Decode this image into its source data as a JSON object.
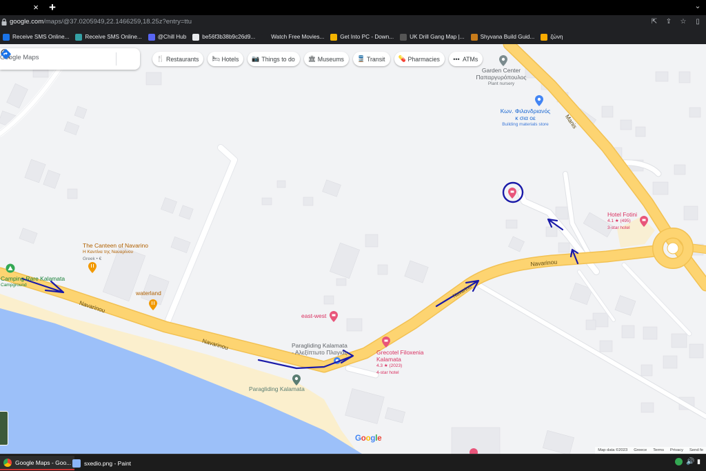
{
  "browser": {
    "tab_close_label": "×",
    "new_tab_label": "+",
    "url_host": "google.com",
    "url_path": "/maps/@37.0205949,22.1466259,18.25z?entry=ttu"
  },
  "bookmarks": [
    {
      "label": "Receive SMS Online...",
      "color": "#1a73e8"
    },
    {
      "label": "Receive SMS Online...",
      "color": "#34a0a4"
    },
    {
      "label": "@Chill Hub",
      "color": "#5865f2"
    },
    {
      "label": "be56f3b38b9c26d9...",
      "color": "#e8eaed"
    },
    {
      "label": "Watch Free Movies...",
      "color": "#202124"
    },
    {
      "label": "Get Into PC - Down...",
      "color": "#f4b400"
    },
    {
      "label": "UK Drill Gang Map |...",
      "color": "#555"
    },
    {
      "label": "Shyvana Build Guid...",
      "color": "#c77b1a"
    },
    {
      "label": "ζώνη",
      "color": "#f9ab00"
    }
  ],
  "search": {
    "placeholder": "Google Maps"
  },
  "chips": [
    {
      "label": "Restaurants",
      "icon": "🍴"
    },
    {
      "label": "Hotels",
      "icon": "🛏"
    },
    {
      "label": "Things to do",
      "icon": "📷"
    },
    {
      "label": "Museums",
      "icon": "🏛"
    },
    {
      "label": "Transit",
      "icon": "🚆"
    },
    {
      "label": "Pharmacies",
      "icon": "💊"
    },
    {
      "label": "ATMs",
      "icon": "•••"
    }
  ],
  "places": {
    "garden_center": {
      "title": "Garden Center",
      "title2": "Παπαργυρόπουλος",
      "sub": "Plant nursery"
    },
    "kon": {
      "title": "Κων. Φιλανδριανός",
      "title2": "κ σια οε",
      "sub": "Building materials store"
    },
    "hotel_fotini": {
      "title": "Hotel Fotini",
      "rating": "4.1 ★ (495)",
      "sub": "3-star hotel"
    },
    "canteen": {
      "title": "The Canteen of Navarino",
      "title2": "Η Καντίνα της Ναυαρίνου",
      "sub": "Greek • €"
    },
    "camping": {
      "title": "Camping Rare Kalamata",
      "sub": "Campground"
    },
    "waterland": {
      "title": "waterland"
    },
    "east_west": {
      "title": "east-west"
    },
    "paragliding_kal": {
      "title": "Paragliding Kalamata",
      "title2": "- Αλεξίπτωτο Πλαγιάς"
    },
    "grecotel": {
      "title": "Grecotel Filoxenia",
      "title2": "Kalamata",
      "rating": "4.3 ★ (2023)",
      "sub": "4-star hotel"
    },
    "paragliding": {
      "title": "Paragliding Kalamata"
    }
  },
  "roads": {
    "navarinou1": "Navarinou",
    "navarinou2": "Navarinou",
    "navarinou3": "Navarinou",
    "navarinou4": "Navarino",
    "manis": "Manis"
  },
  "map_footer": {
    "google": "Google",
    "map_data": "Map data ©2023",
    "country": "Greece",
    "terms": "Terms",
    "privacy": "Privacy",
    "send": "Send fe"
  },
  "taskbar": {
    "tasks": [
      {
        "label": "Google Maps - Goo...",
        "color": "#fbbc04"
      },
      {
        "label": "sxedio.png - Paint",
        "color": "#8ab4f8"
      }
    ]
  },
  "colors": {
    "road_main": "#fdd471",
    "road_edge": "#f2c152",
    "sea": "#9cc0f9",
    "beach": "#fbeec9",
    "annotation": "#1a1aa8",
    "pin_red": "#ea4335",
    "pin_orange": "#e8710a",
    "text_orange": "#b06000",
    "text_blue": "#1967d2",
    "text_pink": "#d93060"
  }
}
